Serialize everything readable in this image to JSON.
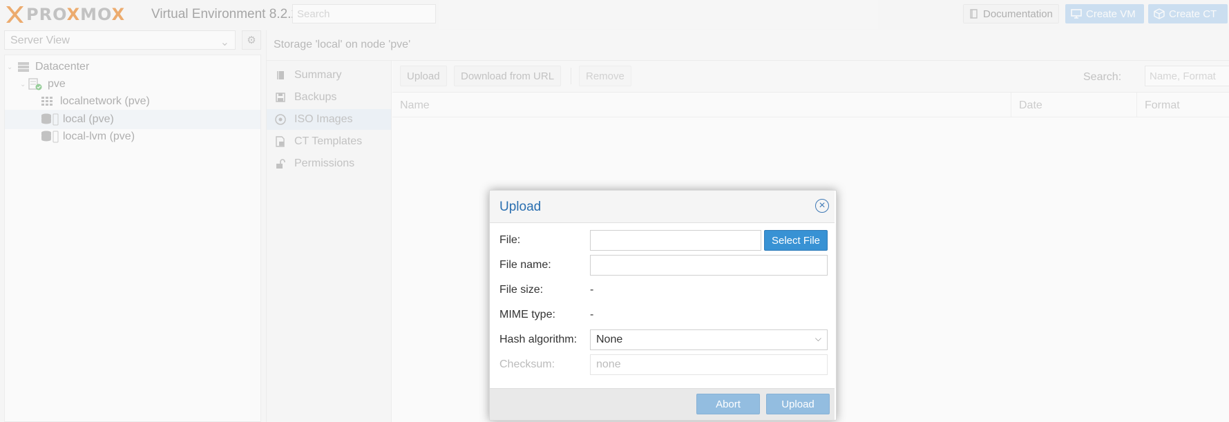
{
  "header": {
    "logo_text_left": "PRO",
    "logo_text_x": "X",
    "logo_text_mid": "MO",
    "logo_text_x2": "X",
    "version": "Virtual Environment 8.2.2",
    "search_placeholder": "Search",
    "documentation_label": "Documentation",
    "create_vm_label": "Create VM",
    "create_ct_label": "Create CT"
  },
  "left_panel": {
    "view_select_value": "Server View",
    "tree": [
      {
        "label": "Datacenter",
        "icon": "datacenter-icon"
      },
      {
        "label": "pve",
        "icon": "node-icon"
      },
      {
        "label": "localnetwork (pve)",
        "icon": "network-zone-icon"
      },
      {
        "label": "local (pve)",
        "icon": "storage-icon",
        "selected": true
      },
      {
        "label": "local-lvm (pve)",
        "icon": "storage-icon"
      }
    ]
  },
  "content": {
    "title": "Storage 'local' on node 'pve'",
    "nav": [
      {
        "label": "Summary",
        "icon": "book-icon"
      },
      {
        "label": "Backups",
        "icon": "floppy-icon"
      },
      {
        "label": "ISO Images",
        "icon": "disc-icon",
        "active": true
      },
      {
        "label": "CT Templates",
        "icon": "template-icon"
      },
      {
        "label": "Permissions",
        "icon": "unlock-icon"
      }
    ],
    "toolbar": {
      "upload_label": "Upload",
      "download_label": "Download from URL",
      "remove_label": "Remove",
      "search_label": "Search:",
      "search_placeholder": "Name, Format"
    },
    "columns": [
      "Name",
      "Date",
      "Format"
    ]
  },
  "modal": {
    "title": "Upload",
    "fields": {
      "file_label": "File:",
      "file_value": "",
      "select_file_label": "Select File",
      "file_name_label": "File name:",
      "file_name_value": "",
      "file_size_label": "File size:",
      "file_size_value": "-",
      "mime_label": "MIME type:",
      "mime_value": "-",
      "hash_label": "Hash algorithm:",
      "hash_value": "None",
      "checksum_label": "Checksum:",
      "checksum_placeholder": "none"
    },
    "abort_label": "Abort",
    "upload_label": "Upload"
  },
  "colors": {
    "accent": "#3892d4",
    "logo_orange": "#e57000",
    "modal_title": "#2a6fb0"
  }
}
